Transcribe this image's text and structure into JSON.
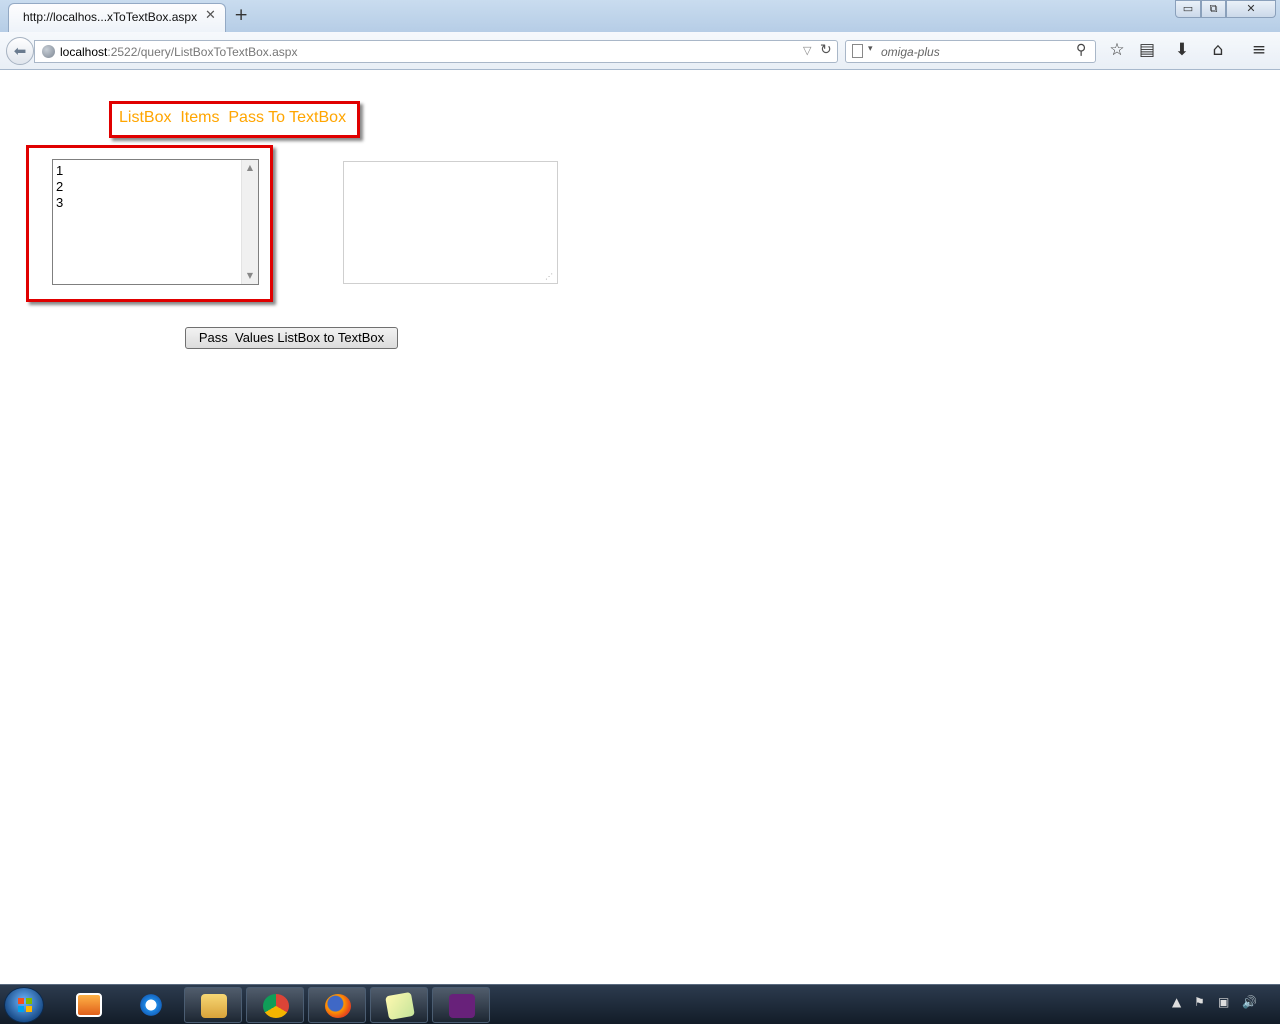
{
  "browser": {
    "tab_title": "http://localhos...xToTextBox.aspx",
    "tab_close": "✕",
    "new_tab": "+",
    "window_controls": {
      "minimize": "▭",
      "maximize": "⧉",
      "close": "✕"
    },
    "url_host": "localhost",
    "url_path": ":2522/query/ListBoxToTextBox.aspx",
    "search_placeholder": "omiga-plus",
    "icons": [
      "back-arrow-icon",
      "globe-icon",
      "reload-icon",
      "search-icon",
      "bookmark-star-icon",
      "reading-list-icon",
      "download-icon",
      "home-icon",
      "menu-icon"
    ]
  },
  "page": {
    "title": "ListBox  Items  Pass To TextBox",
    "listbox_items": [
      "1",
      "2",
      "3"
    ],
    "textarea_value": "",
    "button_label": "Pass  Values ListBox to TextBox"
  },
  "colors": {
    "highlight_border": "#e00000",
    "title_text": "#ffa500"
  },
  "taskbar": {
    "apps": [
      "windows-media-player-icon",
      "internet-explorer-icon",
      "file-explorer-icon",
      "chrome-icon",
      "firefox-icon",
      "sticky-notes-icon",
      "visual-studio-icon"
    ]
  }
}
